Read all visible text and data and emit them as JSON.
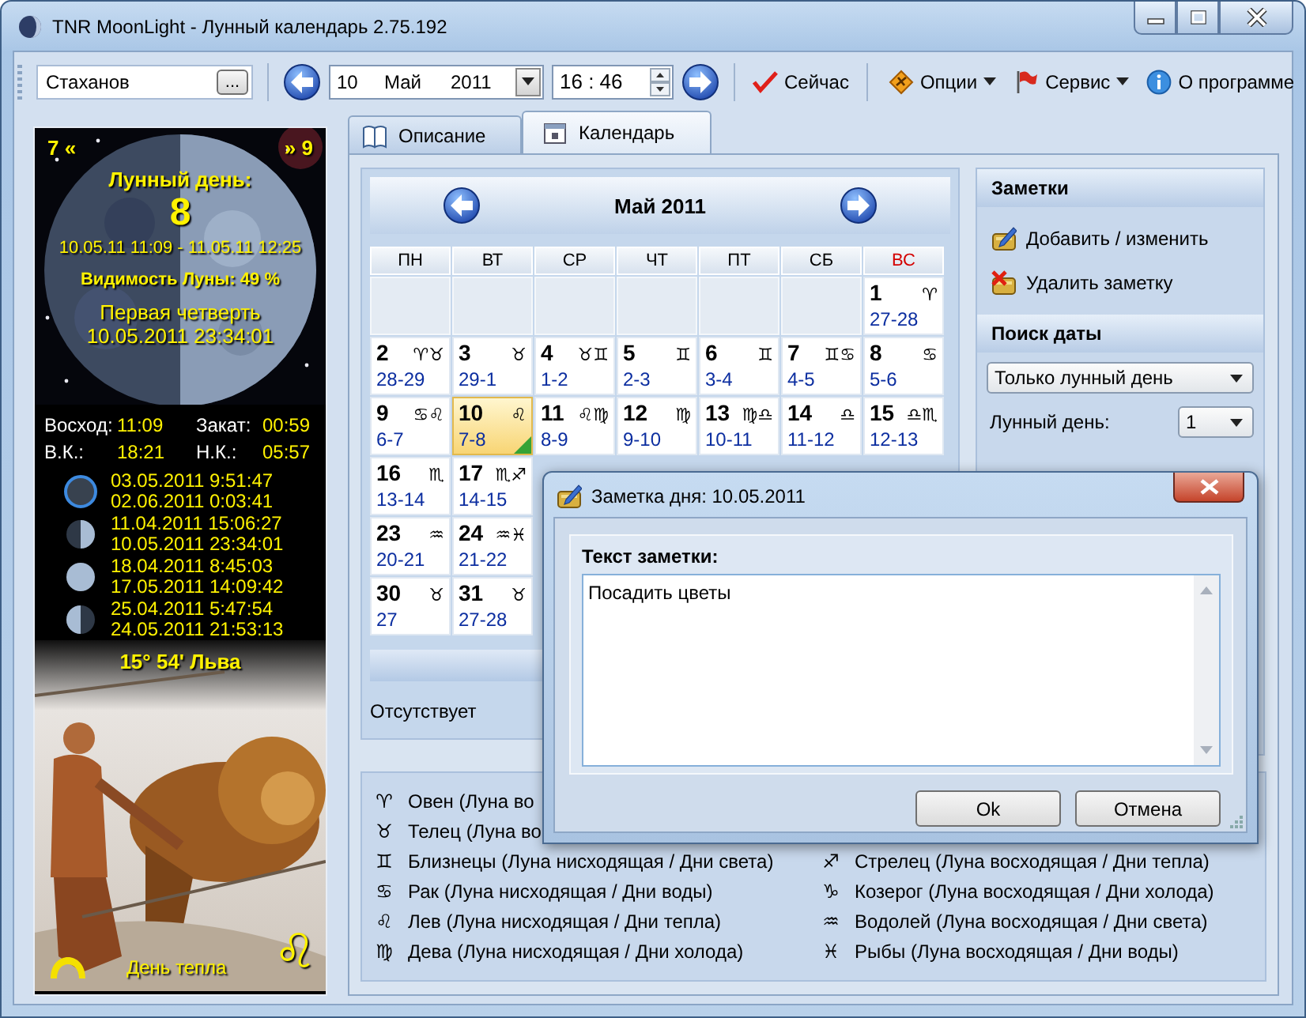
{
  "window": {
    "title": "TNR MoonLight - Лунный календарь 2.75.192"
  },
  "toolbar": {
    "city": "Стаханов",
    "browse_label": "...",
    "date": {
      "day": "10",
      "month": "Май",
      "year": "2011"
    },
    "time": "16 : 46",
    "items": [
      {
        "kind": "now",
        "label": "Сейчас",
        "dropdown": false
      },
      {
        "kind": "options",
        "label": "Опции",
        "dropdown": true
      },
      {
        "kind": "service",
        "label": "Сервис",
        "dropdown": true
      },
      {
        "kind": "about",
        "label": "О программе",
        "dropdown": false
      }
    ]
  },
  "moon_panel": {
    "prev_day": "7 «",
    "next_day": "» 9",
    "lunar_day_label": "Лунный день:",
    "lunar_day": "8",
    "lunar_day_span": "10.05.11 11:09 - 11.05.11 12:25",
    "visibility": "Видимость Луны: 49 %",
    "phase_name": "Первая четверть",
    "phase_time": "10.05.2011 23:34:01",
    "times": [
      {
        "label": "Восход:",
        "value": "11:09"
      },
      {
        "label": "Закат:",
        "value": "00:59"
      },
      {
        "label": "В.К.:",
        "value": "18:21"
      },
      {
        "label": "Н.К.:",
        "value": "05:57"
      }
    ],
    "phases": [
      {
        "kind": "new",
        "highlighted": true,
        "dates": [
          "03.05.2011 9:51:47",
          "02.06.2011 0:03:41"
        ]
      },
      {
        "kind": "first_quarter",
        "highlighted": false,
        "dates": [
          "11.04.2011 15:06:27",
          "10.05.2011 23:34:01"
        ]
      },
      {
        "kind": "full",
        "highlighted": false,
        "dates": [
          "18.04.2011 8:45:03",
          "17.05.2011 14:09:42"
        ]
      },
      {
        "kind": "last_quarter",
        "highlighted": false,
        "dates": [
          "25.04.2011 5:47:54",
          "24.05.2011 21:53:13"
        ]
      }
    ],
    "zodiac_position": "15° 54' Льва",
    "day_type": "День тепла",
    "sign": "♌"
  },
  "tabs": [
    {
      "label": "Описание",
      "kind": "book",
      "selected": false
    },
    {
      "label": "Календарь",
      "kind": "calendar",
      "selected": true
    }
  ],
  "calendar": {
    "title": "Май 2011",
    "weekdays": [
      {
        "label": "ПН",
        "weekend": false
      },
      {
        "label": "ВТ",
        "weekend": false
      },
      {
        "label": "СР",
        "weekend": false
      },
      {
        "label": "ЧТ",
        "weekend": false
      },
      {
        "label": "ПТ",
        "weekend": false
      },
      {
        "label": "СБ",
        "weekend": false
      },
      {
        "label": "ВС",
        "weekend": true
      }
    ],
    "weeks": [
      [
        {
          "kind": "empty"
        },
        {
          "kind": "empty"
        },
        {
          "kind": "empty"
        },
        {
          "kind": "empty"
        },
        {
          "kind": "empty"
        },
        {
          "kind": "empty"
        },
        {
          "kind": "day",
          "day": "1",
          "signs": "♈",
          "lunar": "27-28",
          "selected": false,
          "note": false
        }
      ],
      [
        {
          "kind": "day",
          "day": "2",
          "signs": "♈♉",
          "lunar": "28-29",
          "selected": false,
          "note": false
        },
        {
          "kind": "day",
          "day": "3",
          "signs": "♉",
          "lunar": "29-1",
          "selected": false,
          "note": false
        },
        {
          "kind": "day",
          "day": "4",
          "signs": "♉♊",
          "lunar": "1-2",
          "selected": false,
          "note": false
        },
        {
          "kind": "day",
          "day": "5",
          "signs": "♊",
          "lunar": "2-3",
          "selected": false,
          "note": false
        },
        {
          "kind": "day",
          "day": "6",
          "signs": "♊",
          "lunar": "3-4",
          "selected": false,
          "note": false
        },
        {
          "kind": "day",
          "day": "7",
          "signs": "♊♋",
          "lunar": "4-5",
          "selected": false,
          "note": false
        },
        {
          "kind": "day",
          "day": "8",
          "signs": "♋",
          "lunar": "5-6",
          "selected": false,
          "note": false
        }
      ],
      [
        {
          "kind": "day",
          "day": "9",
          "signs": "♋♌",
          "lunar": "6-7",
          "selected": false,
          "note": false
        },
        {
          "kind": "day",
          "day": "10",
          "signs": "♌",
          "lunar": "7-8",
          "selected": true,
          "note": true
        },
        {
          "kind": "day",
          "day": "11",
          "signs": "♌♍",
          "lunar": "8-9",
          "selected": false,
          "note": false
        },
        {
          "kind": "day",
          "day": "12",
          "signs": "♍",
          "lunar": "9-10",
          "selected": false,
          "note": false
        },
        {
          "kind": "day",
          "day": "13",
          "signs": "♍♎",
          "lunar": "10-11",
          "selected": false,
          "note": false
        },
        {
          "kind": "day",
          "day": "14",
          "signs": "♎",
          "lunar": "11-12",
          "selected": false,
          "note": false
        },
        {
          "kind": "day",
          "day": "15",
          "signs": "♎♏",
          "lunar": "12-13",
          "selected": false,
          "note": false
        }
      ],
      [
        {
          "kind": "day",
          "day": "16",
          "signs": "♏",
          "lunar": "13-14",
          "selected": false,
          "note": false
        },
        {
          "kind": "day",
          "day": "17",
          "signs": "♏♐",
          "lunar": "14-15",
          "selected": false,
          "note": false
        }
      ],
      [
        {
          "kind": "day",
          "day": "23",
          "signs": "♒",
          "lunar": "20-21",
          "selected": false,
          "note": false
        },
        {
          "kind": "day",
          "day": "24",
          "signs": "♒♓",
          "lunar": "21-22",
          "selected": false,
          "note": false
        }
      ],
      [
        {
          "kind": "day",
          "day": "30",
          "signs": "♉",
          "lunar": "27",
          "selected": false,
          "note": false
        },
        {
          "kind": "day",
          "day": "31",
          "signs": "♉",
          "lunar": "27-28",
          "selected": false,
          "note": false
        }
      ]
    ],
    "status": "Отсутствует"
  },
  "notes_panel": {
    "title": "Заметки",
    "actions": [
      {
        "kind": "edit",
        "label": "Добавить / изменить"
      },
      {
        "kind": "delete",
        "label": "Удалить заметку"
      }
    ]
  },
  "date_search": {
    "title": "Поиск даты",
    "mode": "Только лунный день",
    "lunar_day_label": "Лунный день:",
    "lunar_day": "1"
  },
  "legend": {
    "left": [
      {
        "sign": "♈",
        "text": "Овен (Луна во"
      },
      {
        "sign": "♉",
        "text": "Телец (Луна во"
      },
      {
        "sign": "♊",
        "text": "Близнецы (Луна нисходящая / Дни света)"
      },
      {
        "sign": "♋",
        "text": "Рак (Луна нисходящая / Дни воды)"
      },
      {
        "sign": "♌",
        "text": "Лев (Луна нисходящая / Дни тепла)"
      },
      {
        "sign": "♍",
        "text": "Дева (Луна нисходящая / Дни холода)"
      }
    ],
    "right": [
      {
        "sign": "♐",
        "text": "Стрелец (Луна восходящая / Дни тепла)"
      },
      {
        "sign": "♑",
        "text": "Козерог (Луна восходящая / Дни холода)"
      },
      {
        "sign": "♒",
        "text": "Водолей (Луна восходящая / Дни света)"
      },
      {
        "sign": "♓",
        "text": "Рыбы (Луна восходящая / Дни воды)"
      }
    ]
  },
  "dialog": {
    "title": "Заметка дня: 10.05.2011",
    "field_label": "Текст заметки:",
    "note_text": "Посадить цветы",
    "buttons": [
      "Ok",
      "Отмена"
    ]
  }
}
